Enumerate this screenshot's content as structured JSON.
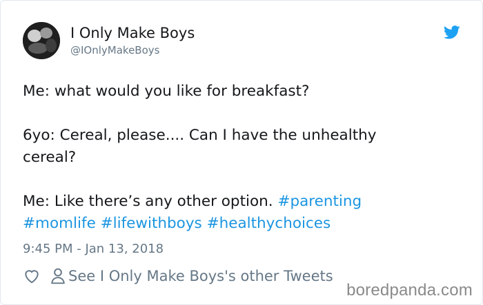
{
  "user": {
    "display_name": "I Only Make Boys",
    "handle": "@IOnlyMakeBoys"
  },
  "tweet": {
    "line_1": "Me: what would you like for breakfast?",
    "line_2": "6yo: Cereal, please.... Can I have the unhealthy",
    "line_3": "cereal?",
    "line_4_text": "Me: Like there’s any other option. ",
    "hashtags": [
      "#parenting",
      "#momlife",
      "#lifewithboys",
      "#healthychoices"
    ],
    "timestamp": "9:45 PM - Jan 13, 2018"
  },
  "actions": {
    "see_other": "See I Only Make Boys's other Tweets"
  },
  "watermark": "boredpanda.com",
  "icons": {
    "twitter_logo": "twitter-bird-icon",
    "like": "heart-icon",
    "profile": "person-icon"
  },
  "colors": {
    "hashtag": "#1b95e0",
    "twitter_blue": "#1da1f2",
    "secondary_text": "#657786"
  }
}
